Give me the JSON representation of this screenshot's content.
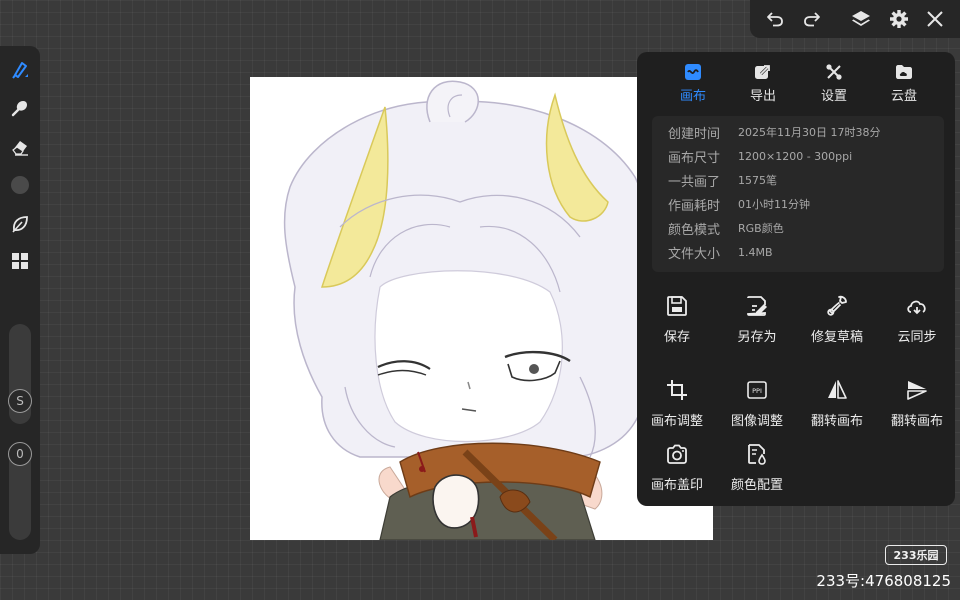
{
  "top_toolbar": {
    "icons": [
      "undo-icon",
      "redo-icon",
      "layers-icon",
      "gear-icon",
      "close-icon"
    ]
  },
  "left_toolbar": {
    "tools": [
      "brush-icon",
      "smudge-icon",
      "eraser-icon",
      "color-swatch",
      "leaf-icon",
      "grid-icon"
    ],
    "size_label": "S",
    "opacity_label": "0",
    "swatch_color": "#4a4a4a"
  },
  "panel": {
    "tabs": [
      {
        "label": "画布",
        "icon": "canvas-icon",
        "active": true
      },
      {
        "label": "导出",
        "icon": "export-icon",
        "active": false
      },
      {
        "label": "设置",
        "icon": "tools-icon",
        "active": false
      },
      {
        "label": "云盘",
        "icon": "cloud-folder-icon",
        "active": false
      }
    ],
    "info": [
      {
        "key": "创建时间",
        "value": "2025年11月30日 17时38分"
      },
      {
        "key": "画布尺寸",
        "value": "1200×1200 - 300ppi"
      },
      {
        "key": "一共画了",
        "value": "1575笔"
      },
      {
        "key": "作画耗时",
        "value": "01小时11分钟"
      },
      {
        "key": "颜色模式",
        "value": "RGB颜色"
      },
      {
        "key": "文件大小",
        "value": "1.4MB"
      }
    ],
    "actions": [
      {
        "label": "保存",
        "icon": "save-icon"
      },
      {
        "label": "另存为",
        "icon": "save-as-icon"
      },
      {
        "label": "修复草稿",
        "icon": "wrench-icon"
      },
      {
        "label": "云同步",
        "icon": "cloud-sync-icon"
      },
      {
        "label": "画布调整",
        "icon": "crop-icon"
      },
      {
        "label": "图像调整",
        "icon": "ppi-icon"
      },
      {
        "label": "翻转画布",
        "icon": "flip-horizontal-icon"
      },
      {
        "label": "翻转画布",
        "icon": "flip-vertical-icon"
      },
      {
        "label": "画布盖印",
        "icon": "camera-icon"
      },
      {
        "label": "颜色配置",
        "icon": "color-profile-icon"
      }
    ],
    "ppi_icon_text": "PPI"
  },
  "watermark": {
    "logo_text": "233乐园",
    "id_text": "233号:476808125"
  },
  "colors": {
    "accent": "#2f8bff",
    "panel_bg": "#1f1f1f",
    "workspace_bg": "#3a3a3a"
  }
}
